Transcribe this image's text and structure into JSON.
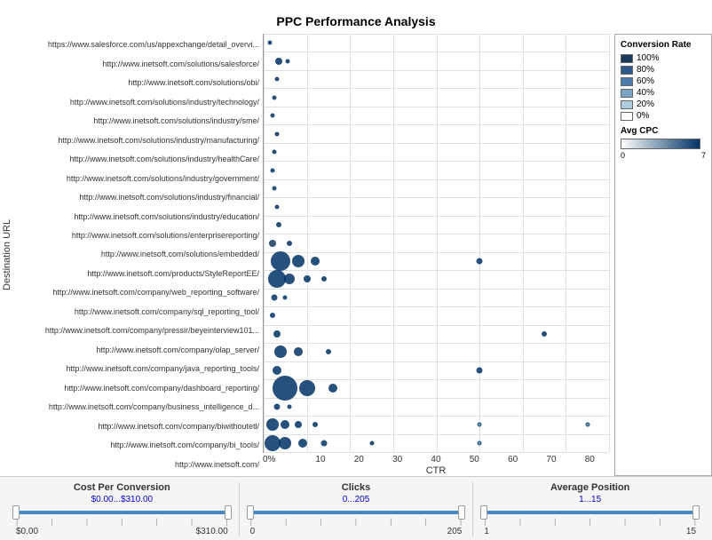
{
  "title": "PPC Performance Analysis",
  "yAxisLabel": "Destination URL",
  "xAxisLabel": "CTR",
  "xAxisTicks": [
    "0%",
    "10",
    "20",
    "30",
    "40",
    "50",
    "60",
    "70",
    "80"
  ],
  "urls": [
    "https://www.salesforce.com/us/appexchange/detail_overvi...",
    "http://www.inetsoft.com/solutions/salesforce/",
    "http://www.inetsoft.com/solutions/obi/",
    "http://www.inetsoft.com/solutions/industry/technology/",
    "http://www.inetsoft.com/solutions/industry/sme/",
    "http://www.inetsoft.com/solutions/industry/manufacturing/",
    "http://www.inetsoft.com/solutions/industry/healthCare/",
    "http://www.inetsoft.com/solutions/industry/government/",
    "http://www.inetsoft.com/solutions/industry/financial/",
    "http://www.inetsoft.com/solutions/industry/education/",
    "http://www.inetsoft.com/solutions/enterprisereporting/",
    "http://www.inetsoft.com/solutions/embedded/",
    "http://www.inetsoft.com/products/StyleReportEE/",
    "http://www.inetsoft.com/company/web_reporting_software/",
    "http://www.inetsoft.com/company/sql_reporting_tool/",
    "http://www.inetsoft.com/company/pressir/beyeinterview101...",
    "http://www.inetsoft.com/company/olap_server/",
    "http://www.inetsoft.com/company/java_reporting_tools/",
    "http://www.inetsoft.com/company/dashboard_reporting/",
    "http://www.inetsoft.com/company/business_intelligence_d...",
    "http://www.inetsoft.com/company/biwithoutetl/",
    "http://www.inetsoft.com/company/bi_tools/",
    "http://www.inetsoft.com/"
  ],
  "legend": {
    "conversionTitle": "Conversion Rate",
    "items": [
      {
        "label": "100%",
        "color": "#1a3a5c"
      },
      {
        "label": "80%",
        "color": "#2e5986"
      },
      {
        "label": "60%",
        "color": "#4a7aaa"
      },
      {
        "label": "40%",
        "color": "#7ba4c4"
      },
      {
        "label": "20%",
        "color": "#b0ccde"
      },
      {
        "label": "0%",
        "color": "#ffffff"
      }
    ],
    "cpcTitle": "Avg CPC",
    "cpcMin": "0",
    "cpcMax": "7"
  },
  "sliders": [
    {
      "title": "Cost Per Conversion",
      "rangeText": "$0.00...$310.00",
      "minLabel": "$0.00",
      "maxLabel": "$310.00",
      "fillPercent": 100,
      "ticks": [
        "",
        "",
        "",
        "",
        "",
        "",
        ""
      ]
    },
    {
      "title": "Clicks",
      "rangeText": "0...205",
      "minLabel": "0",
      "maxLabel": "205",
      "fillPercent": 100,
      "ticks": [
        "",
        "",
        "",
        "",
        "",
        "",
        ""
      ]
    },
    {
      "title": "Average Position",
      "rangeText": "1...15",
      "minLabel": "1",
      "maxLabel": "15",
      "fillPercent": 100,
      "ticks": [
        "",
        "",
        "",
        "",
        "",
        "",
        ""
      ]
    }
  ],
  "bubbles": [
    {
      "urlIndex": 0,
      "ctrPct": 1.5,
      "size": 5,
      "fill": "#003366"
    },
    {
      "urlIndex": 1,
      "ctrPct": 3.5,
      "size": 8,
      "fill": "#003366"
    },
    {
      "urlIndex": 1,
      "ctrPct": 5.5,
      "size": 5,
      "fill": "#003366"
    },
    {
      "urlIndex": 2,
      "ctrPct": 3,
      "size": 5,
      "fill": "#003366"
    },
    {
      "urlIndex": 3,
      "ctrPct": 2.5,
      "size": 5,
      "fill": "#003366"
    },
    {
      "urlIndex": 4,
      "ctrPct": 2,
      "size": 5,
      "fill": "#003366"
    },
    {
      "urlIndex": 5,
      "ctrPct": 3,
      "size": 5,
      "fill": "#003366"
    },
    {
      "urlIndex": 6,
      "ctrPct": 2.5,
      "size": 5,
      "fill": "#003366"
    },
    {
      "urlIndex": 7,
      "ctrPct": 2,
      "size": 5,
      "fill": "#003366"
    },
    {
      "urlIndex": 8,
      "ctrPct": 2.5,
      "size": 5,
      "fill": "#003366"
    },
    {
      "urlIndex": 9,
      "ctrPct": 3,
      "size": 5,
      "fill": "#003366"
    },
    {
      "urlIndex": 10,
      "ctrPct": 3.5,
      "size": 6,
      "fill": "#003366"
    },
    {
      "urlIndex": 11,
      "ctrPct": 2,
      "size": 8,
      "fill": "#1a3a5c"
    },
    {
      "urlIndex": 11,
      "ctrPct": 6,
      "size": 6,
      "fill": "#003366"
    },
    {
      "urlIndex": 12,
      "ctrPct": 4,
      "size": 22,
      "fill": "#003366"
    },
    {
      "urlIndex": 12,
      "ctrPct": 8,
      "size": 14,
      "fill": "#003366"
    },
    {
      "urlIndex": 12,
      "ctrPct": 12,
      "size": 10,
      "fill": "#003366"
    },
    {
      "urlIndex": 12,
      "ctrPct": 50,
      "size": 7,
      "fill": "#003366"
    },
    {
      "urlIndex": 13,
      "ctrPct": 3,
      "size": 20,
      "fill": "#003366"
    },
    {
      "urlIndex": 13,
      "ctrPct": 6,
      "size": 12,
      "fill": "#003366"
    },
    {
      "urlIndex": 13,
      "ctrPct": 10,
      "size": 8,
      "fill": "#003366"
    },
    {
      "urlIndex": 13,
      "ctrPct": 14,
      "size": 6,
      "fill": "#003366"
    },
    {
      "urlIndex": 14,
      "ctrPct": 2.5,
      "size": 7,
      "fill": "#003366"
    },
    {
      "urlIndex": 14,
      "ctrPct": 5,
      "size": 5,
      "fill": "#003366"
    },
    {
      "urlIndex": 15,
      "ctrPct": 2,
      "size": 6,
      "fill": "#003366"
    },
    {
      "urlIndex": 16,
      "ctrPct": 3,
      "size": 8,
      "fill": "#003366"
    },
    {
      "urlIndex": 16,
      "ctrPct": 65,
      "size": 6,
      "fill": "#003366"
    },
    {
      "urlIndex": 17,
      "ctrPct": 4,
      "size": 14,
      "fill": "#003366"
    },
    {
      "urlIndex": 17,
      "ctrPct": 8,
      "size": 10,
      "fill": "#003366"
    },
    {
      "urlIndex": 17,
      "ctrPct": 15,
      "size": 6,
      "fill": "#003366"
    },
    {
      "urlIndex": 18,
      "ctrPct": 3,
      "size": 10,
      "fill": "#003366"
    },
    {
      "urlIndex": 18,
      "ctrPct": 50,
      "size": 7,
      "fill": "#003366"
    },
    {
      "urlIndex": 19,
      "ctrPct": 5,
      "size": 28,
      "fill": "#003366"
    },
    {
      "urlIndex": 19,
      "ctrPct": 10,
      "size": 18,
      "fill": "#003366"
    },
    {
      "urlIndex": 19,
      "ctrPct": 16,
      "size": 10,
      "fill": "#003366"
    },
    {
      "urlIndex": 20,
      "ctrPct": 3,
      "size": 7,
      "fill": "#003366"
    },
    {
      "urlIndex": 20,
      "ctrPct": 6,
      "size": 5,
      "fill": "#003366"
    },
    {
      "urlIndex": 21,
      "ctrPct": 2,
      "size": 14,
      "fill": "#003366"
    },
    {
      "urlIndex": 21,
      "ctrPct": 5,
      "size": 10,
      "fill": "#003366"
    },
    {
      "urlIndex": 21,
      "ctrPct": 8,
      "size": 8,
      "fill": "#003366"
    },
    {
      "urlIndex": 21,
      "ctrPct": 12,
      "size": 6,
      "fill": "#003366"
    },
    {
      "urlIndex": 21,
      "ctrPct": 50,
      "size": 5,
      "fill": "#4488aa"
    },
    {
      "urlIndex": 21,
      "ctrPct": 75,
      "size": 5,
      "fill": "#4488aa"
    },
    {
      "urlIndex": 22,
      "ctrPct": 2,
      "size": 18,
      "fill": "#003366"
    },
    {
      "urlIndex": 22,
      "ctrPct": 5,
      "size": 14,
      "fill": "#003366"
    },
    {
      "urlIndex": 22,
      "ctrPct": 9,
      "size": 10,
      "fill": "#003366"
    },
    {
      "urlIndex": 22,
      "ctrPct": 14,
      "size": 7,
      "fill": "#003366"
    },
    {
      "urlIndex": 22,
      "ctrPct": 25,
      "size": 5,
      "fill": "#003366"
    },
    {
      "urlIndex": 22,
      "ctrPct": 50,
      "size": 5,
      "fill": "#4488aa"
    }
  ]
}
